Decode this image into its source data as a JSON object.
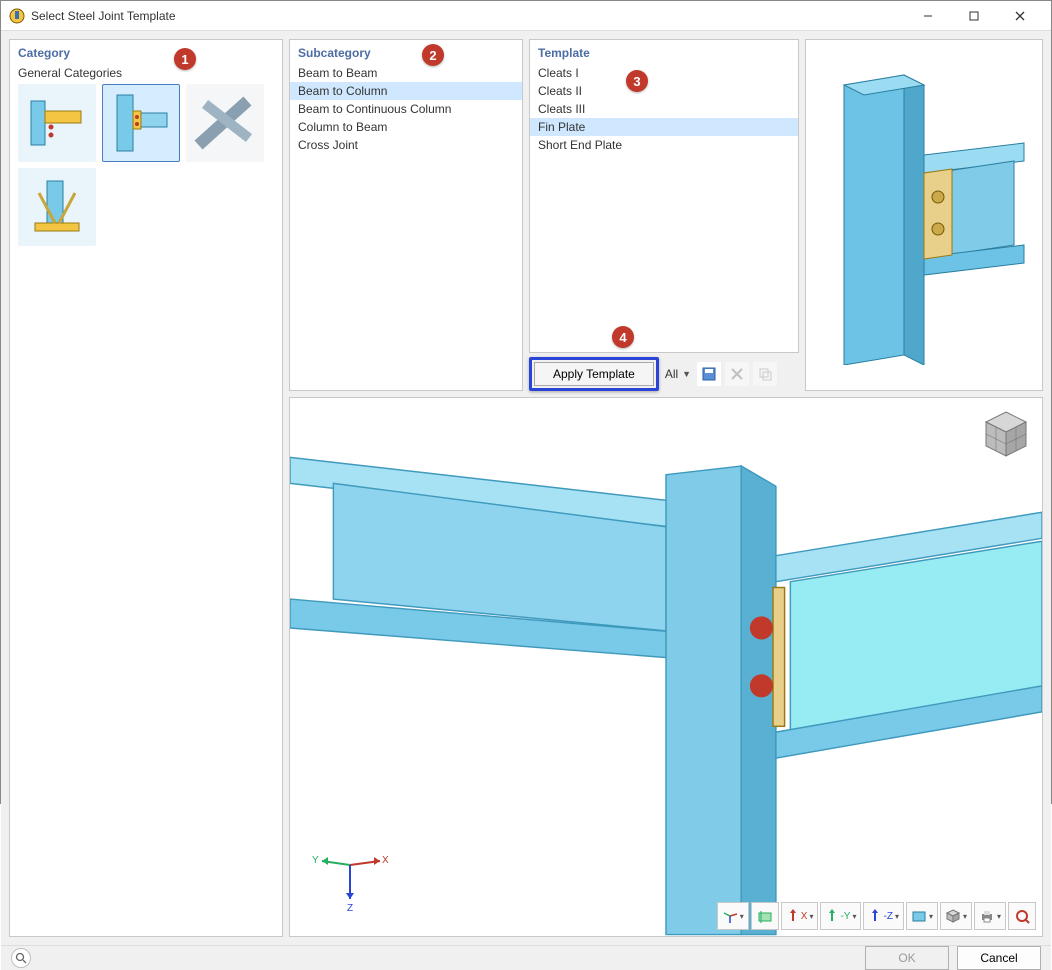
{
  "window": {
    "title": "Select Steel Joint Template"
  },
  "category": {
    "header": "Category",
    "section_label": "General Categories",
    "callout": "1",
    "items": [
      {
        "name": "beam-column-angle-template"
      },
      {
        "name": "beam-column-fin-template",
        "selected": true
      },
      {
        "name": "truss-member-template"
      },
      {
        "name": "column-base-template"
      }
    ]
  },
  "subcategory": {
    "header": "Subcategory",
    "callout": "2",
    "items": [
      {
        "label": "Beam to Beam"
      },
      {
        "label": "Beam to Column",
        "selected": true
      },
      {
        "label": "Beam to Continuous Column"
      },
      {
        "label": "Column to Beam"
      },
      {
        "label": "Cross Joint"
      }
    ]
  },
  "template": {
    "header": "Template",
    "callout": "3",
    "items": [
      {
        "label": "Cleats I"
      },
      {
        "label": "Cleats II"
      },
      {
        "label": "Cleats III"
      },
      {
        "label": "Fin Plate",
        "selected": true
      },
      {
        "label": "Short End Plate"
      }
    ]
  },
  "apply": {
    "callout": "4",
    "button_label": "Apply Template",
    "filter_label": "All"
  },
  "viewport_toolbar": {
    "buttons": [
      {
        "name": "axis-toggle-button",
        "has_menu": true
      },
      {
        "name": "show-dimensions-button"
      },
      {
        "name": "view-x-button",
        "label": "X",
        "has_menu": true
      },
      {
        "name": "view-y-button",
        "label": "-Y",
        "has_menu": true
      },
      {
        "name": "view-z-button",
        "label": "-Z",
        "has_menu": true
      },
      {
        "name": "display-mode-button",
        "has_menu": true
      },
      {
        "name": "isometric-button",
        "has_menu": true
      },
      {
        "name": "print-button",
        "has_menu": true
      },
      {
        "name": "reset-view-button"
      }
    ]
  },
  "footer": {
    "ok": "OK",
    "cancel": "Cancel"
  }
}
